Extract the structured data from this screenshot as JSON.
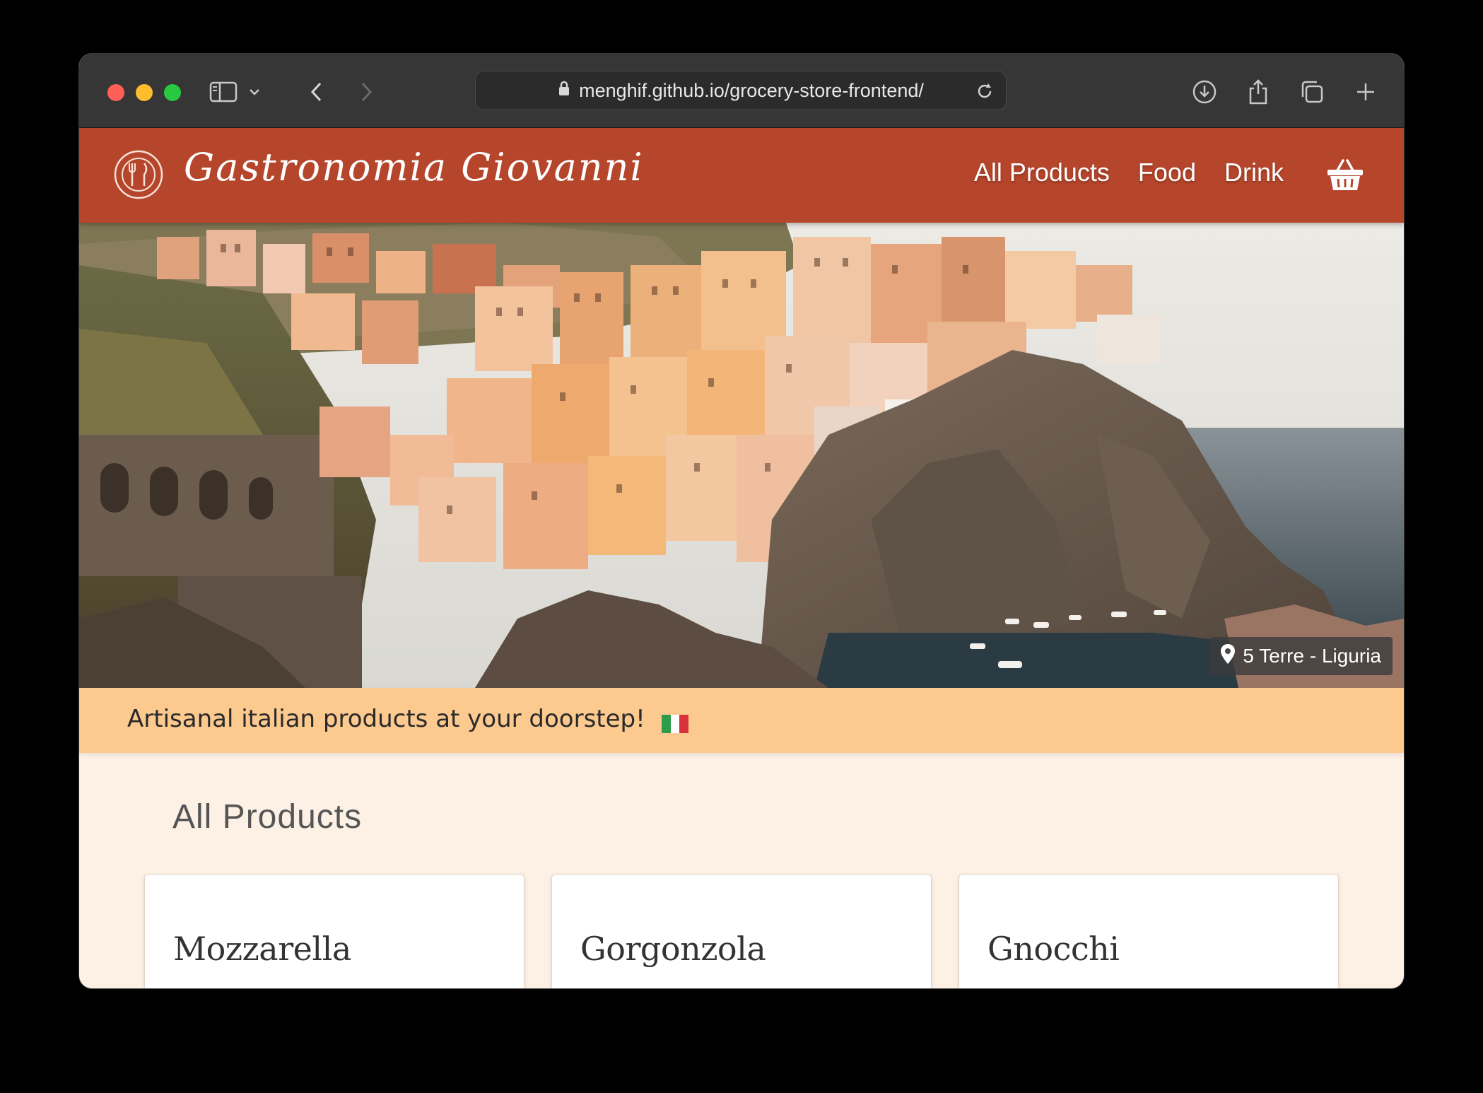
{
  "browser": {
    "url": "menghif.github.io/grocery-store-frontend/"
  },
  "header": {
    "brand": "Gastronomia Giovanni",
    "nav": [
      {
        "label": "All Products"
      },
      {
        "label": "Food"
      },
      {
        "label": "Drink"
      }
    ],
    "cart_icon": "basket-icon",
    "logo_icon": "fork-knife-plate-icon"
  },
  "hero": {
    "location": "5 Terre - Liguria",
    "location_icon": "map-pin-icon"
  },
  "tagline": {
    "text": "Artisanal italian products at your doorstep!",
    "flag_icon": "italy-flag-icon"
  },
  "main": {
    "section_title": "All Products",
    "products": [
      {
        "name": "Mozzarella"
      },
      {
        "name": "Gorgonzola"
      },
      {
        "name": "Gnocchi"
      }
    ]
  },
  "colors": {
    "header_bg": "#b5452b",
    "tagline_bg": "#fcc98f",
    "page_bg": "#fdf1e6",
    "chrome_bg": "#363636"
  }
}
